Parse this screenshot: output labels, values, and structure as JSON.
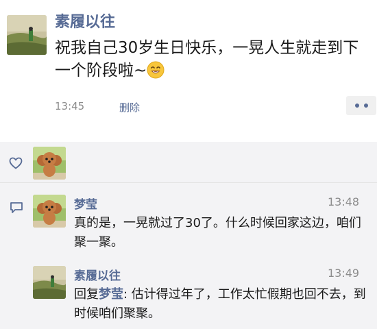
{
  "post": {
    "nickname": "素履以往",
    "content": "祝我自己30岁生日快乐，一晃人生就走到下一个阶段啦~",
    "emoji": "smiling-face-icon",
    "time": "13:45",
    "delete_label": "删除",
    "more_icon": "more-dots-icon"
  },
  "likes": {
    "icon": "heart-icon",
    "avatars": [
      "poodle-avatar"
    ]
  },
  "comments": {
    "icon": "comment-bubble-icon",
    "items": [
      {
        "nickname": "梦莹",
        "time": "13:48",
        "avatar": "poodle-avatar",
        "text": "真的是，一晃就过了30了。什么时候回家这边，咱们聚一聚。"
      },
      {
        "nickname": "素履以往",
        "time": "13:49",
        "avatar": "landscape-avatar",
        "reply_prefix": "回复",
        "reply_to": "梦莹",
        "text": ": 估计得过年了，工作太忙假期也回不去，到时候咱们聚聚。"
      }
    ]
  },
  "colors": {
    "link": "#576b95",
    "comment_bg": "#f3f3f5"
  }
}
